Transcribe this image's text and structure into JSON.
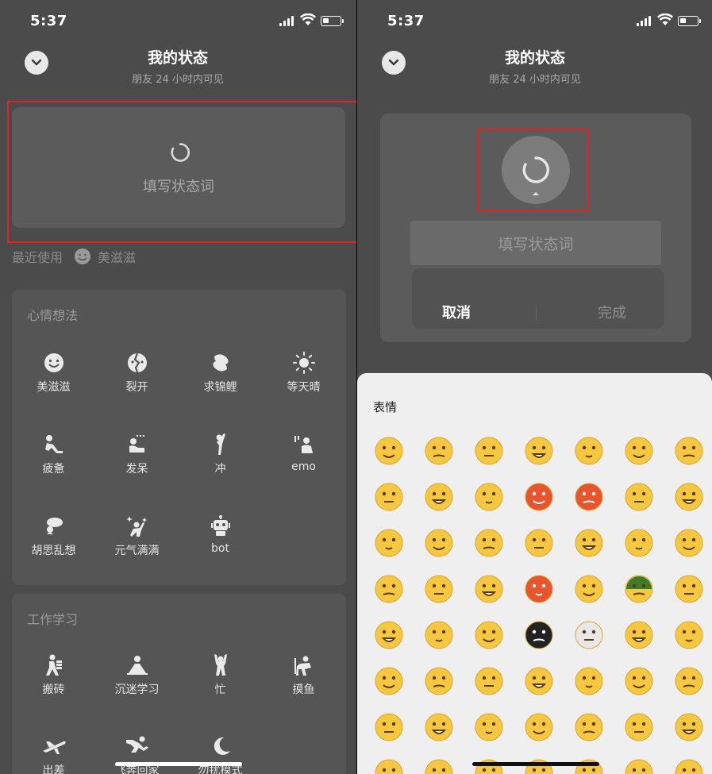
{
  "status_bar": {
    "time": "5:37"
  },
  "header": {
    "title": "我的状态",
    "subtitle": "朋友 24 小时内可见"
  },
  "status_card": {
    "placeholder": "填写状态词"
  },
  "recent": {
    "label": "最近使用",
    "item": "美滋滋"
  },
  "mood_section": {
    "title": "心情想法",
    "items": [
      {
        "label": "美滋滋",
        "icon": "smile-icon"
      },
      {
        "label": "裂开",
        "icon": "cracked-icon"
      },
      {
        "label": "求锦鲤",
        "icon": "koi-icon"
      },
      {
        "label": "等天晴",
        "icon": "sun-icon"
      },
      {
        "label": "疲惫",
        "icon": "tired-icon"
      },
      {
        "label": "发呆",
        "icon": "daze-icon"
      },
      {
        "label": "冲",
        "icon": "rush-icon"
      },
      {
        "label": "emo",
        "icon": "emo-icon"
      },
      {
        "label": "胡思乱想",
        "icon": "thinking-icon"
      },
      {
        "label": "元气满满",
        "icon": "energetic-icon"
      },
      {
        "label": "bot",
        "icon": "robot-icon"
      }
    ]
  },
  "work_section": {
    "title": "工作学习",
    "items": [
      {
        "label": "搬砖",
        "icon": "brick-icon"
      },
      {
        "label": "沉迷学习",
        "icon": "study-icon"
      },
      {
        "label": "忙",
        "icon": "busy-icon"
      },
      {
        "label": "摸鱼",
        "icon": "slacking-icon"
      },
      {
        "label": "出差",
        "icon": "plane-icon"
      },
      {
        "label": "飞奔回家",
        "icon": "running-icon"
      },
      {
        "label": "勿扰模式",
        "icon": "moon-icon"
      }
    ]
  },
  "edit_card": {
    "placeholder": "填写状态词",
    "cancel": "取消",
    "done": "完成"
  },
  "emoji_sheet": {
    "title": "表情"
  },
  "colors": {
    "background": "#4b4b4b",
    "card": "#5b5b5b",
    "highlight": "#e02424",
    "sheet": "#efefef",
    "emoji": "#f6c842"
  }
}
